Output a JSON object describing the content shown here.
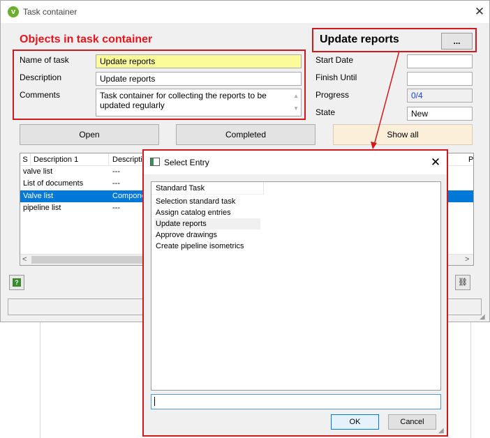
{
  "main_window": {
    "title": "Task container",
    "heading": "Objects in task container",
    "task_name_label": "Name of task",
    "task_name_value": "Update reports",
    "description_label": "Description",
    "description_value": "Update reports",
    "comments_label": "Comments",
    "comments_value": "Task container for collecting the reports to be updated regularly",
    "top_right_title": "Update reports",
    "browse_button": "...",
    "start_date_label": "Start Date",
    "start_date_value": "",
    "finish_until_label": "Finish Until",
    "finish_until_value": "",
    "progress_label": "Progress",
    "progress_value": "0/4",
    "state_label": "State",
    "state_value": "New",
    "buttons": {
      "open": "Open",
      "completed": "Completed",
      "show_all": "Show all"
    },
    "list": {
      "columns": [
        "S",
        "Description 1",
        "Descriptio",
        "P"
      ],
      "rows": [
        {
          "desc1": "valve list",
          "desc2": "---"
        },
        {
          "desc1": "List of documents",
          "desc2": "---"
        },
        {
          "desc1": "Valve list",
          "desc2": "Compone"
        },
        {
          "desc1": "pipeline list",
          "desc2": "---"
        }
      ],
      "selected_index": 2
    }
  },
  "dialog": {
    "title": "Select Entry",
    "list_header": "Standard Task",
    "entries": [
      "Selection standard task",
      "Assign catalog entries",
      "Update reports",
      "Approve drawings",
      "Create pipeline isometrics"
    ],
    "highlighted_index": 2,
    "filter_value": "",
    "ok_label": "OK",
    "cancel_label": "Cancel"
  },
  "colors": {
    "annotation_red": "#d0181d",
    "heading_red": "#e8141b",
    "selection_blue": "#0078d7",
    "highlight_yellow": "#fbfb9a",
    "show_all_bg": "#fbefd9"
  }
}
